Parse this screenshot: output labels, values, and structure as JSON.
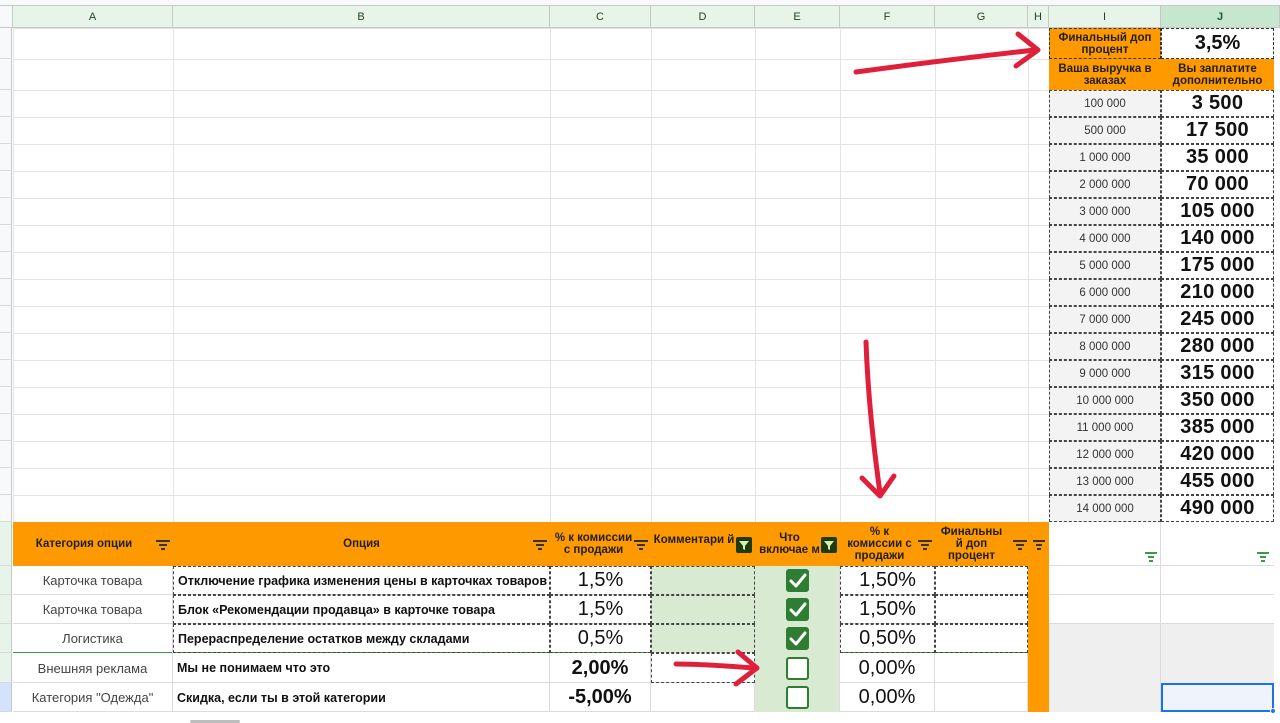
{
  "columns": [
    "A",
    "B",
    "C",
    "D",
    "E",
    "F",
    "G",
    "H",
    "I",
    "J"
  ],
  "summary": {
    "label_final": "Финальный доп процент",
    "final_value": "3,5%",
    "header_revenue": "Ваша выручка в заказах",
    "header_pay": "Вы заплатите дополнительно",
    "rows": [
      {
        "revenue": "100 000",
        "pay": "3 500"
      },
      {
        "revenue": "500 000",
        "pay": "17 500"
      },
      {
        "revenue": "1 000 000",
        "pay": "35 000"
      },
      {
        "revenue": "2 000 000",
        "pay": "70 000"
      },
      {
        "revenue": "3 000 000",
        "pay": "105 000"
      },
      {
        "revenue": "4 000 000",
        "pay": "140 000"
      },
      {
        "revenue": "5 000 000",
        "pay": "175 000"
      },
      {
        "revenue": "6 000 000",
        "pay": "210 000"
      },
      {
        "revenue": "7 000 000",
        "pay": "245 000"
      },
      {
        "revenue": "8 000 000",
        "pay": "280 000"
      },
      {
        "revenue": "9 000 000",
        "pay": "315 000"
      },
      {
        "revenue": "10 000 000",
        "pay": "350 000"
      },
      {
        "revenue": "11 000 000",
        "pay": "385 000"
      },
      {
        "revenue": "12 000 000",
        "pay": "420 000"
      },
      {
        "revenue": "13 000 000",
        "pay": "455 000"
      },
      {
        "revenue": "14 000 000",
        "pay": "490 000"
      }
    ]
  },
  "table": {
    "headers": {
      "category": "Категория опции",
      "option": "Опция",
      "commission": "% к комиссии с продажи",
      "comment": "Комментари й",
      "included": "Что включае м",
      "commission_sale": "% к комиссии с продажи",
      "final": "Финальны й доп процент"
    },
    "rows": [
      {
        "category": "Карточка товара",
        "option": "Отключение графика изменения цены в карточках товаров",
        "commission": "1,5%",
        "included": true,
        "pct": "1,50%"
      },
      {
        "category": "Карточка товара",
        "option": "Блок «Рекомендации продавца» в карточке товара",
        "commission": "1,5%",
        "included": true,
        "pct": "1,50%"
      },
      {
        "category": "Логистика",
        "option": "Перераспределение остатков между складами",
        "commission": "0,5%",
        "included": true,
        "pct": "0,50%"
      },
      {
        "category": "Внешняя реклама",
        "option": "Мы не понимаем что это",
        "commission": "2,00%",
        "included": false,
        "pct": "0,00%"
      },
      {
        "category": "Категория \"Одежда\"",
        "option": "Скидка, если ты в этой категории",
        "commission": "-5,00%",
        "included": false,
        "pct": "0,00%"
      }
    ]
  },
  "colors": {
    "accent": "#ff9900",
    "checkbox": "#2e7d32",
    "arrow": "#e0203a",
    "selection": "#1a73e8"
  }
}
